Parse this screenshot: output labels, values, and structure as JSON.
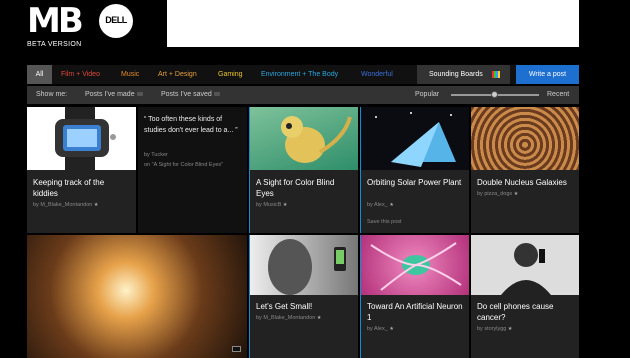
{
  "logo": {
    "letters": "MB",
    "brand": "DELL",
    "tagline": "BETA VERSION"
  },
  "nav": {
    "tabs": [
      {
        "label": "All",
        "color": "#ffffff"
      },
      {
        "label": "Film + Video",
        "color": "#e0483b"
      },
      {
        "label": "Music",
        "color": "#e58a2a"
      },
      {
        "label": "Art + Design",
        "color": "#e6a03a"
      },
      {
        "label": "Gaming",
        "color": "#e8c62a"
      },
      {
        "label": "Environment + The Body",
        "color": "#2aa7e0"
      },
      {
        "label": "Wonderful",
        "color": "#3a6fd8"
      }
    ],
    "sounding_boards": "Sounding Boards",
    "write_post": "Write a post"
  },
  "subbar": {
    "show_me": "Show me:",
    "posts_made": "Posts I've made",
    "posts_saved": "Posts I've saved",
    "popular": "Popular",
    "recent": "Recent",
    "slider_position": 0.45
  },
  "cards": [
    {
      "title": "Keeping track of the kiddies",
      "byline": "by M_Blake_Montandon"
    },
    {
      "quote": "Too often these kinds of studies don't ever lead to a... ",
      "quote_by": "by Tucker",
      "quote_on": "on \"A Sight for Color Blind Eyes\""
    },
    {
      "title": "A Sight for Color Blind Eyes",
      "byline": "by MusicB"
    },
    {
      "title": "Orbiting Solar Power Plant",
      "byline": "by Alex_",
      "save": "Save this post"
    },
    {
      "title": "Double Nucleus Galaxies",
      "byline": "by pizza_dogs"
    },
    {
      "title": "Let's Get Small!",
      "byline": "by M_Blake_Montandon"
    },
    {
      "title": "Toward An Artificial Neuron 1",
      "byline": "by Alex_"
    },
    {
      "title": "Do cell phones cause cancer?",
      "byline": "by storylygg"
    }
  ]
}
